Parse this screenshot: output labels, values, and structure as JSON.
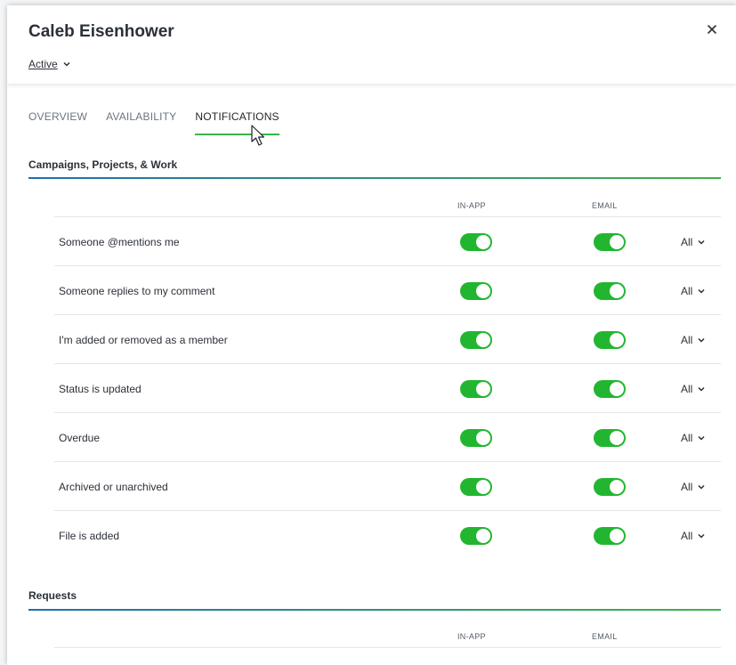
{
  "header": {
    "user_name": "Caleb Eisenhower",
    "status": "Active"
  },
  "tabs": [
    {
      "label": "OVERVIEW",
      "active": false
    },
    {
      "label": "AVAILABILITY",
      "active": false
    },
    {
      "label": "NOTIFICATIONS",
      "active": true
    }
  ],
  "sections": [
    {
      "title": "Campaigns, Projects, & Work",
      "columns": {
        "in_app": "IN-APP",
        "email": "EMAIL"
      },
      "rows": [
        {
          "label": "Someone @mentions me",
          "in_app": true,
          "email": true,
          "frequency": "All"
        },
        {
          "label": "Someone replies to my comment",
          "in_app": true,
          "email": true,
          "frequency": "All"
        },
        {
          "label": "I'm added or removed as a member",
          "in_app": true,
          "email": true,
          "frequency": "All"
        },
        {
          "label": "Status is updated",
          "in_app": true,
          "email": true,
          "frequency": "All"
        },
        {
          "label": "Overdue",
          "in_app": true,
          "email": true,
          "frequency": "All"
        },
        {
          "label": "Archived or unarchived",
          "in_app": true,
          "email": true,
          "frequency": "All"
        },
        {
          "label": "File is added",
          "in_app": true,
          "email": true,
          "frequency": "All"
        }
      ]
    },
    {
      "title": "Requests",
      "columns": {
        "in_app": "IN-APP",
        "email": "EMAIL"
      }
    }
  ],
  "colors": {
    "toggle_on": "#22b630",
    "accent_green": "#3cb54a",
    "accent_blue": "#1f6fb0"
  },
  "icons": {
    "close": "close-icon",
    "dropdown": "chevron-down-icon",
    "cursor": "mouse-pointer-icon"
  }
}
